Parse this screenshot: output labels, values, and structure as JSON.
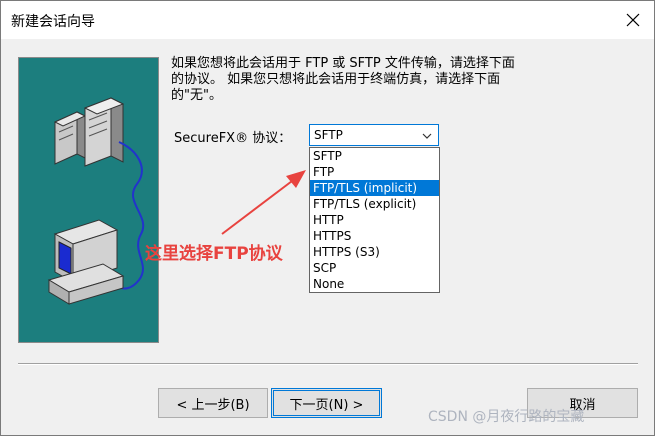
{
  "window": {
    "title": "新建会话向导"
  },
  "description": {
    "line1": "如果您想将此会话用于 FTP 或 SFTP 文件传输，请选择下面",
    "line2": "的协议。 如果您只想将此会话用于终端仿真，请选择下面",
    "line3": "的\"无\"。"
  },
  "protocol": {
    "label": "SecureFX® 协议：",
    "selected": "SFTP",
    "options": [
      "SFTP",
      "FTP",
      "FTP/TLS (implicit)",
      "FTP/TLS (explicit)",
      "HTTP",
      "HTTPS",
      "HTTPS (S3)",
      "SCP",
      "None"
    ],
    "highlighted": "FTP/TLS (implicit)"
  },
  "annotation": {
    "text": "这里选择FTP协议",
    "color": "#e8433f"
  },
  "buttons": {
    "back": "< 上一步(B)",
    "next": "下一页(N) >",
    "cancel": "取消"
  },
  "watermark": "CSDN @月夜行路的宝藏",
  "icons": {
    "close": "close-icon",
    "dropdown": "chevron-down-icon",
    "illustration": "network-computer-illustration"
  },
  "colors": {
    "accent": "#0078d7",
    "panel": "#1c7e7e",
    "annotation": "#e8433f"
  }
}
